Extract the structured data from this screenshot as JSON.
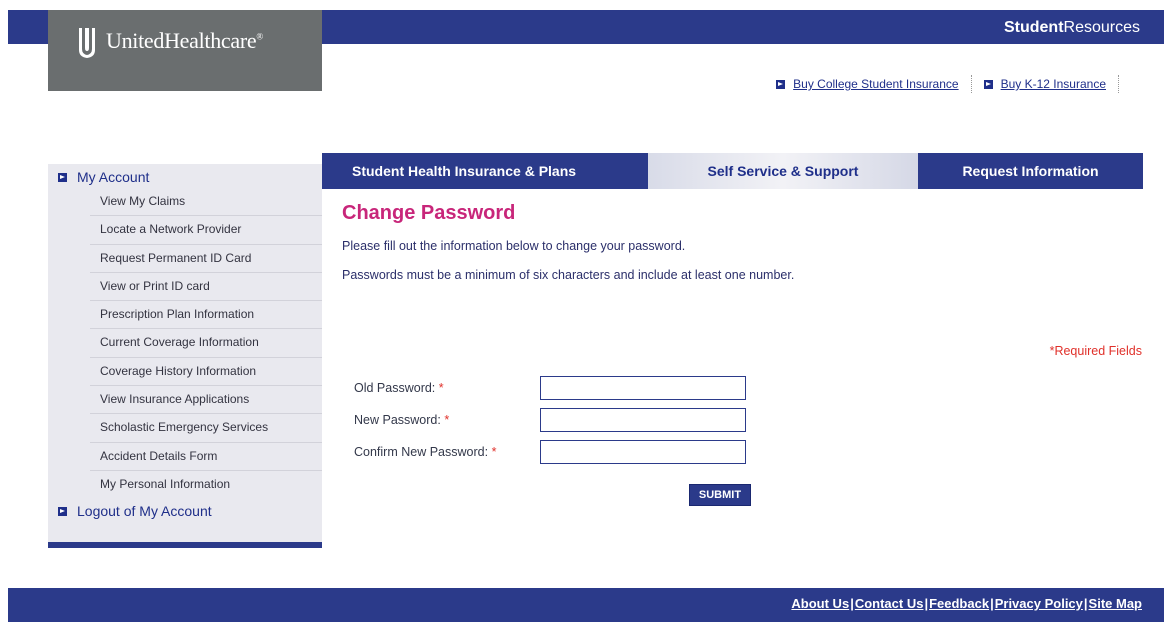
{
  "header": {
    "logo_text": "UnitedHealthcare",
    "logo_mark": "®",
    "brand_bold": "Student",
    "brand_rest": "Resources",
    "buy_links": [
      {
        "label": "Buy College Student Insurance"
      },
      {
        "label": "Buy K-12 Insurance"
      }
    ]
  },
  "tabs": [
    {
      "label": "Student Health Insurance & Plans",
      "active": false
    },
    {
      "label": "Self Service & Support",
      "active": true
    },
    {
      "label": "Request Information",
      "active": false
    }
  ],
  "sidebar": {
    "account_heading": "My Account",
    "items": [
      {
        "label": "View My Claims"
      },
      {
        "label": "Locate a Network Provider"
      },
      {
        "label": "Request Permanent ID Card"
      },
      {
        "label": "View or Print ID card"
      },
      {
        "label": "Prescription Plan Information"
      },
      {
        "label": "Current Coverage Information"
      },
      {
        "label": "Coverage History Information"
      },
      {
        "label": "View Insurance Applications"
      },
      {
        "label": "Scholastic Emergency Services"
      },
      {
        "label": "Accident Details Form"
      },
      {
        "label": "My Personal Information"
      }
    ],
    "logout_label": "Logout of My Account"
  },
  "main": {
    "title": "Change Password",
    "intro": "Please fill out the information below to change your password.",
    "rule": "Passwords must be a minimum of six characters and include at least one number.",
    "required_note": "*Required Fields",
    "fields": [
      {
        "label": "Old Password:",
        "value": ""
      },
      {
        "label": "New Password:",
        "value": ""
      },
      {
        "label": "Confirm New Password:",
        "value": ""
      }
    ],
    "required_mark": "*",
    "submit_label": "SUBMIT"
  },
  "footer": {
    "links": [
      "About Us",
      "Contact Us",
      "Feedback",
      "Privacy Policy",
      "Site Map"
    ],
    "separator": "|"
  },
  "colors": {
    "navy": "#2b3a8a",
    "accent_pink": "#c8267a",
    "required_red": "#e0302a",
    "logo_grey": "#6a6e6f"
  }
}
